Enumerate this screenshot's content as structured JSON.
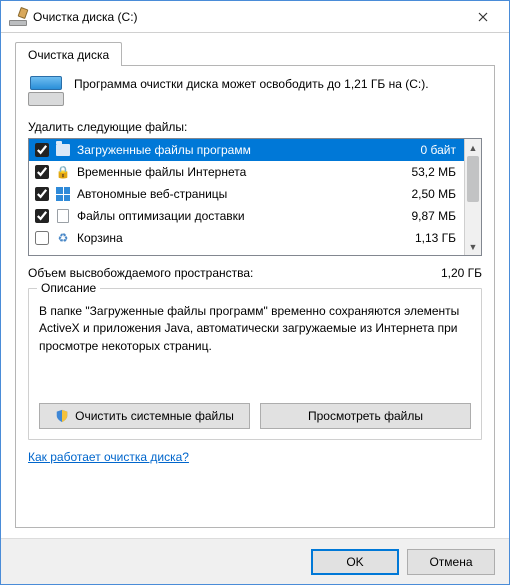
{
  "window": {
    "title": "Очистка диска  (C:)"
  },
  "tab": {
    "label": "Очистка диска"
  },
  "intro": "Программа очистки диска может освободить до 1,21 ГБ на (C:).",
  "prompt": "Удалить следующие файлы:",
  "items": [
    {
      "label": "Загруженные файлы программ",
      "size": "0 байт",
      "checked": true,
      "selected": true,
      "icon": "folder"
    },
    {
      "label": "Временные файлы Интернета",
      "size": "53,2 МБ",
      "checked": true,
      "selected": false,
      "icon": "lock"
    },
    {
      "label": "Автономные веб-страницы",
      "size": "2,50 МБ",
      "checked": true,
      "selected": false,
      "icon": "win"
    },
    {
      "label": "Файлы оптимизации доставки",
      "size": "9,87 МБ",
      "checked": true,
      "selected": false,
      "icon": "page"
    },
    {
      "label": "Корзина",
      "size": "1,13 ГБ",
      "checked": false,
      "selected": false,
      "icon": "bin"
    }
  ],
  "summary": {
    "label": "Объем высвобождаемого пространства:",
    "value": "1,20 ГБ"
  },
  "group": {
    "legend": "Описание",
    "text": "В папке \"Загруженные файлы программ\" временно сохраняются элементы ActiveX и приложения Java, автоматически загружаемые из Интернета при просмотре некоторых страниц."
  },
  "buttons": {
    "clean_system": "Очистить системные файлы",
    "view_files": "Просмотреть файлы"
  },
  "help_link": "Как работает очистка диска?",
  "footer": {
    "ok": "OK",
    "cancel": "Отмена"
  }
}
